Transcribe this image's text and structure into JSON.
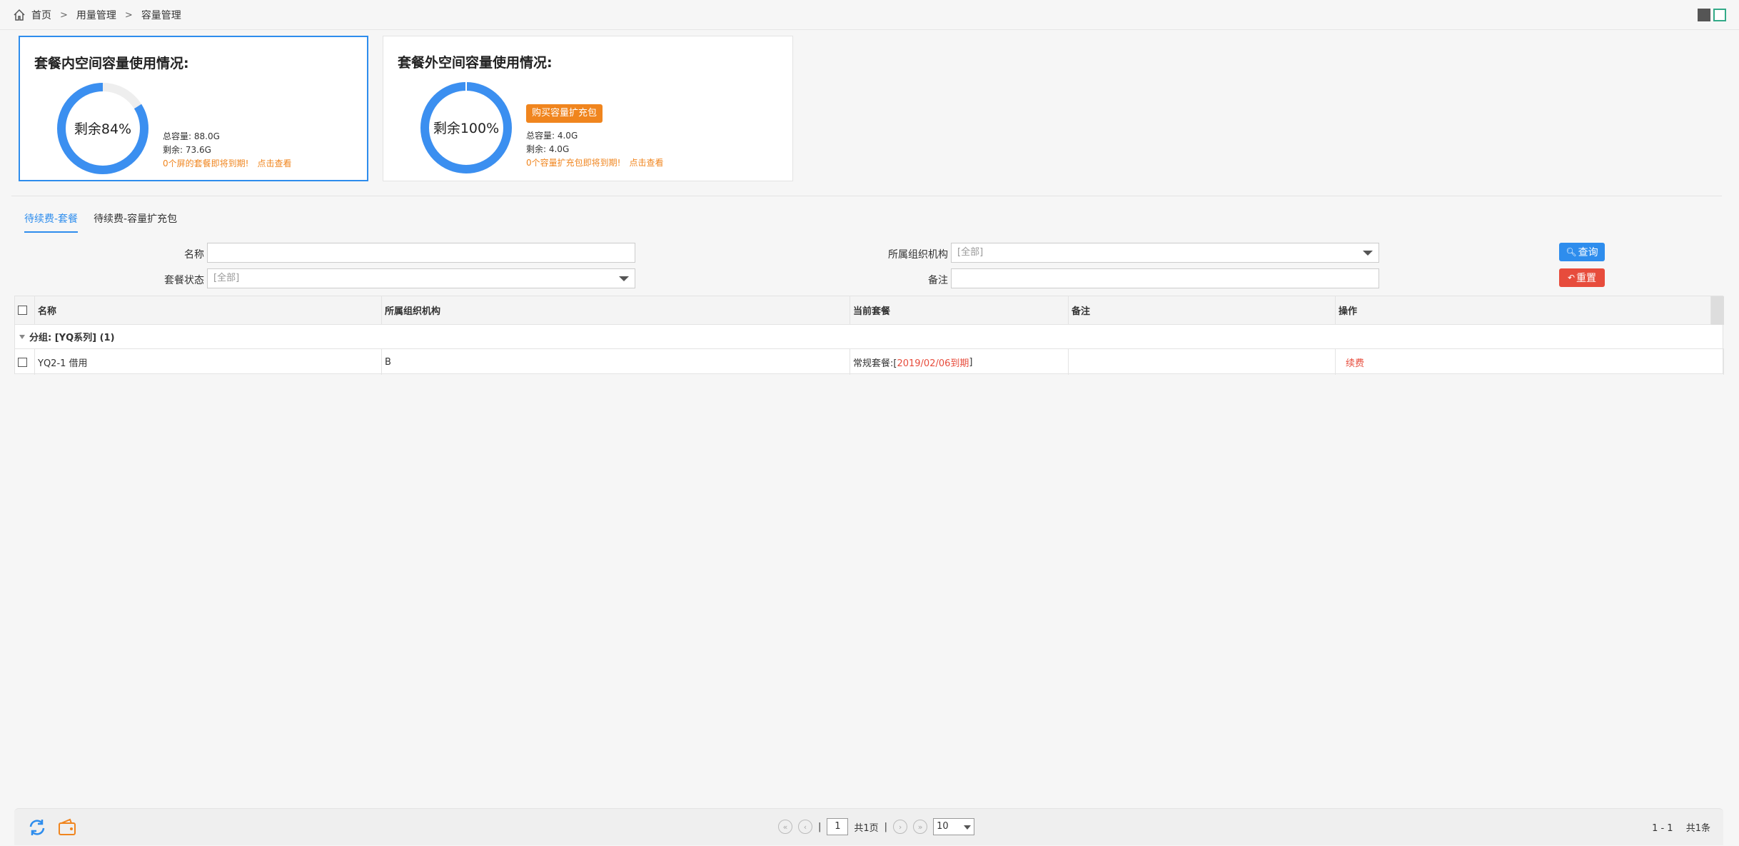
{
  "breadcrumb": {
    "home": "首页",
    "level2": "用量管理",
    "level3": "容量管理"
  },
  "card1": {
    "title": "套餐内空间容量使用情况:",
    "percent_label": "剩余84%",
    "remaining_fraction": 0.84,
    "total": "总容量: 88.0G",
    "remain": "剩余: 73.6G",
    "warn": "0个屏的套餐即将到期!",
    "link": "点击查看"
  },
  "card2": {
    "title": "套餐外空间容量使用情况:",
    "percent_label": "剩余100%",
    "remaining_fraction": 1.0,
    "buy_button": "购买容量扩充包",
    "total": "总容量: 4.0G",
    "remain": "剩余: 4.0G",
    "warn": "0个容量扩充包即将到期!",
    "link": "点击查看"
  },
  "tabs": [
    "待续费-套餐",
    "待续费-容量扩充包"
  ],
  "form": {
    "name_label": "名称",
    "org_label": "所属组织机构",
    "org_value": "[全部]",
    "status_label": "套餐状态",
    "status_value": "[全部]",
    "remark_label": "备注",
    "query_button": "查询",
    "reset_button": "重置"
  },
  "table": {
    "headers": [
      "名称",
      "所属组织机构",
      "当前套餐",
      "备注",
      "操作"
    ],
    "group": "分组: [YQ系列] (1)",
    "rows": [
      {
        "name": "YQ2-1 借用",
        "org": "B",
        "plan": "常规套餐:[",
        "expire": "2019/02/06到期",
        "plan_end": "]",
        "remark": "",
        "action": "续费"
      }
    ]
  },
  "pager": {
    "page": "1",
    "total_pages": "共1页",
    "page_size": "10",
    "range": "1 - 1",
    "total": "共1条"
  },
  "colors": {
    "accent": "#2e8ded",
    "warning": "#f0851e",
    "danger": "#e74c3c"
  }
}
